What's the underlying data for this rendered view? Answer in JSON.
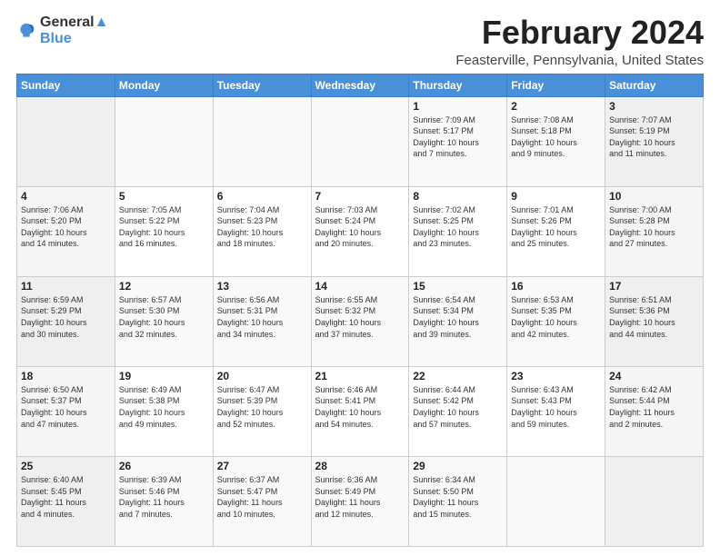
{
  "logo": {
    "line1": "General",
    "line2": "Blue"
  },
  "title": "February 2024",
  "subtitle": "Feasterville, Pennsylvania, United States",
  "days_of_week": [
    "Sunday",
    "Monday",
    "Tuesday",
    "Wednesday",
    "Thursday",
    "Friday",
    "Saturday"
  ],
  "weeks": [
    [
      {
        "num": "",
        "info": ""
      },
      {
        "num": "",
        "info": ""
      },
      {
        "num": "",
        "info": ""
      },
      {
        "num": "",
        "info": ""
      },
      {
        "num": "1",
        "info": "Sunrise: 7:09 AM\nSunset: 5:17 PM\nDaylight: 10 hours\nand 7 minutes."
      },
      {
        "num": "2",
        "info": "Sunrise: 7:08 AM\nSunset: 5:18 PM\nDaylight: 10 hours\nand 9 minutes."
      },
      {
        "num": "3",
        "info": "Sunrise: 7:07 AM\nSunset: 5:19 PM\nDaylight: 10 hours\nand 11 minutes."
      }
    ],
    [
      {
        "num": "4",
        "info": "Sunrise: 7:06 AM\nSunset: 5:20 PM\nDaylight: 10 hours\nand 14 minutes."
      },
      {
        "num": "5",
        "info": "Sunrise: 7:05 AM\nSunset: 5:22 PM\nDaylight: 10 hours\nand 16 minutes."
      },
      {
        "num": "6",
        "info": "Sunrise: 7:04 AM\nSunset: 5:23 PM\nDaylight: 10 hours\nand 18 minutes."
      },
      {
        "num": "7",
        "info": "Sunrise: 7:03 AM\nSunset: 5:24 PM\nDaylight: 10 hours\nand 20 minutes."
      },
      {
        "num": "8",
        "info": "Sunrise: 7:02 AM\nSunset: 5:25 PM\nDaylight: 10 hours\nand 23 minutes."
      },
      {
        "num": "9",
        "info": "Sunrise: 7:01 AM\nSunset: 5:26 PM\nDaylight: 10 hours\nand 25 minutes."
      },
      {
        "num": "10",
        "info": "Sunrise: 7:00 AM\nSunset: 5:28 PM\nDaylight: 10 hours\nand 27 minutes."
      }
    ],
    [
      {
        "num": "11",
        "info": "Sunrise: 6:59 AM\nSunset: 5:29 PM\nDaylight: 10 hours\nand 30 minutes."
      },
      {
        "num": "12",
        "info": "Sunrise: 6:57 AM\nSunset: 5:30 PM\nDaylight: 10 hours\nand 32 minutes."
      },
      {
        "num": "13",
        "info": "Sunrise: 6:56 AM\nSunset: 5:31 PM\nDaylight: 10 hours\nand 34 minutes."
      },
      {
        "num": "14",
        "info": "Sunrise: 6:55 AM\nSunset: 5:32 PM\nDaylight: 10 hours\nand 37 minutes."
      },
      {
        "num": "15",
        "info": "Sunrise: 6:54 AM\nSunset: 5:34 PM\nDaylight: 10 hours\nand 39 minutes."
      },
      {
        "num": "16",
        "info": "Sunrise: 6:53 AM\nSunset: 5:35 PM\nDaylight: 10 hours\nand 42 minutes."
      },
      {
        "num": "17",
        "info": "Sunrise: 6:51 AM\nSunset: 5:36 PM\nDaylight: 10 hours\nand 44 minutes."
      }
    ],
    [
      {
        "num": "18",
        "info": "Sunrise: 6:50 AM\nSunset: 5:37 PM\nDaylight: 10 hours\nand 47 minutes."
      },
      {
        "num": "19",
        "info": "Sunrise: 6:49 AM\nSunset: 5:38 PM\nDaylight: 10 hours\nand 49 minutes."
      },
      {
        "num": "20",
        "info": "Sunrise: 6:47 AM\nSunset: 5:39 PM\nDaylight: 10 hours\nand 52 minutes."
      },
      {
        "num": "21",
        "info": "Sunrise: 6:46 AM\nSunset: 5:41 PM\nDaylight: 10 hours\nand 54 minutes."
      },
      {
        "num": "22",
        "info": "Sunrise: 6:44 AM\nSunset: 5:42 PM\nDaylight: 10 hours\nand 57 minutes."
      },
      {
        "num": "23",
        "info": "Sunrise: 6:43 AM\nSunset: 5:43 PM\nDaylight: 10 hours\nand 59 minutes."
      },
      {
        "num": "24",
        "info": "Sunrise: 6:42 AM\nSunset: 5:44 PM\nDaylight: 11 hours\nand 2 minutes."
      }
    ],
    [
      {
        "num": "25",
        "info": "Sunrise: 6:40 AM\nSunset: 5:45 PM\nDaylight: 11 hours\nand 4 minutes."
      },
      {
        "num": "26",
        "info": "Sunrise: 6:39 AM\nSunset: 5:46 PM\nDaylight: 11 hours\nand 7 minutes."
      },
      {
        "num": "27",
        "info": "Sunrise: 6:37 AM\nSunset: 5:47 PM\nDaylight: 11 hours\nand 10 minutes."
      },
      {
        "num": "28",
        "info": "Sunrise: 6:36 AM\nSunset: 5:49 PM\nDaylight: 11 hours\nand 12 minutes."
      },
      {
        "num": "29",
        "info": "Sunrise: 6:34 AM\nSunset: 5:50 PM\nDaylight: 11 hours\nand 15 minutes."
      },
      {
        "num": "",
        "info": ""
      },
      {
        "num": "",
        "info": ""
      }
    ]
  ]
}
